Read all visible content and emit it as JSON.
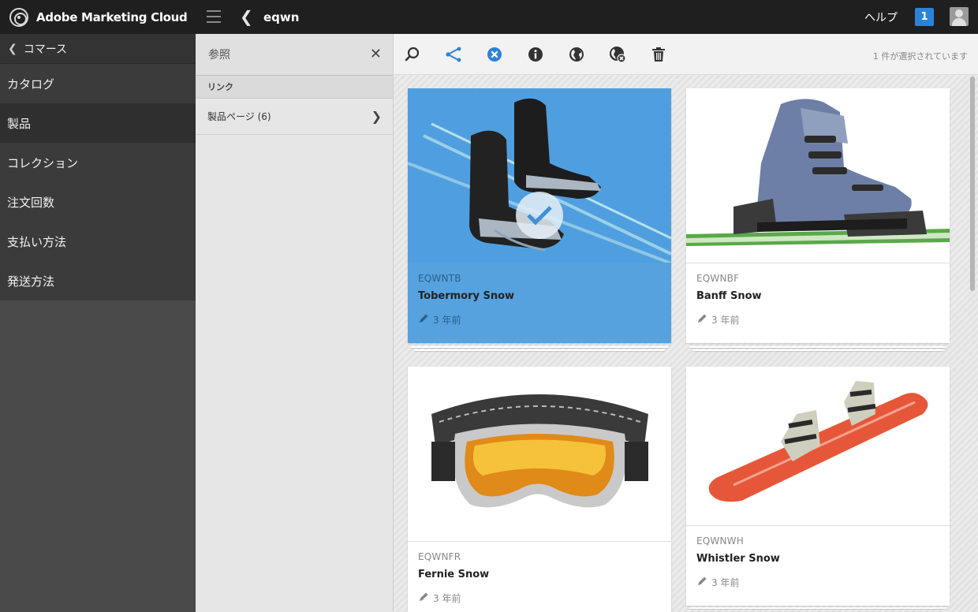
{
  "app": {
    "brand": "Adobe Marketing Cloud",
    "breadcrumb": "eqwn",
    "help_label": "ヘルプ",
    "notification_count": "1"
  },
  "leftnav": {
    "back_label": "コマース",
    "items": [
      {
        "label": "カタログ",
        "active": false
      },
      {
        "label": "製品",
        "active": true
      },
      {
        "label": "コレクション",
        "active": false
      },
      {
        "label": "注文回数",
        "active": false
      },
      {
        "label": "支払い方法",
        "active": false
      },
      {
        "label": "発送方法",
        "active": false
      }
    ]
  },
  "rail": {
    "title": "参照",
    "section": "リンク",
    "link_label": "製品ページ (6)"
  },
  "toolbar": {
    "icons": [
      "search-icon",
      "share-icon",
      "close-circle-icon",
      "info-icon",
      "globe-icon",
      "globe-remove-icon",
      "trash-icon"
    ],
    "selection_status": "1 件が選択されています",
    "accent_color": "#2b82d9"
  },
  "cards": [
    {
      "sku": "EQWNTB",
      "title": "Tobermory Snow",
      "modified": "3 年前",
      "selected": true,
      "image": "ski-boots-on-skis"
    },
    {
      "sku": "EQWNBF",
      "title": "Banff Snow",
      "modified": "3 年前",
      "selected": false,
      "image": "ski-boot"
    },
    {
      "sku": "EQWNFR",
      "title": "Fernie Snow",
      "modified": "3 年前",
      "selected": false,
      "image": "ski-goggles"
    },
    {
      "sku": "EQWNWH",
      "title": "Whistler Snow",
      "modified": "3 年前",
      "selected": false,
      "image": "snowboard"
    }
  ]
}
